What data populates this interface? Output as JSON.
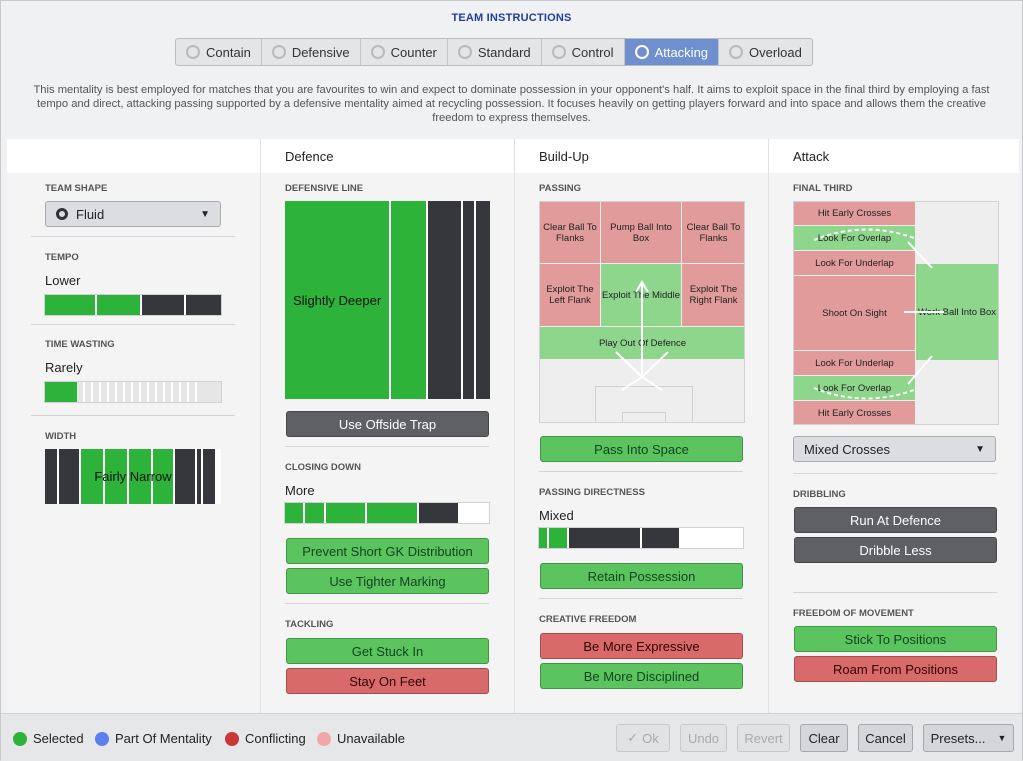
{
  "title": "TEAM INSTRUCTIONS",
  "tabs": [
    {
      "label": "Contain",
      "icon": "contain-icon",
      "active": false
    },
    {
      "label": "Defensive",
      "icon": "shield-icon",
      "active": false
    },
    {
      "label": "Counter",
      "icon": "counter-icon",
      "active": false
    },
    {
      "label": "Standard",
      "icon": "standard-icon",
      "active": false
    },
    {
      "label": "Control",
      "icon": "control-icon",
      "active": false
    },
    {
      "label": "Attacking",
      "icon": "attacking-icon",
      "active": true
    },
    {
      "label": "Overload",
      "icon": "overload-icon",
      "active": false
    }
  ],
  "description": "This mentality is best employed for matches that you are favourites to win and expect to dominate possession in your opponent's half. It aims to exploit space in the final third by employing a fast tempo and direct, attacking passing supported by a defensive mentality aimed at recycling possession. It focuses heavily on getting players forward and into space and allows them the creative freedom to express themselves.",
  "columns": {
    "defence": "Defence",
    "buildup": "Build-Up",
    "attack": "Attack"
  },
  "left": {
    "team_shape_label": "TEAM SHAPE",
    "team_shape_value": "Fluid",
    "tempo_label": "TEMPO",
    "tempo_value": "Lower",
    "time_wasting_label": "TIME WASTING",
    "time_wasting_value": "Rarely",
    "width_label": "WIDTH",
    "width_value": "Fairly Narrow"
  },
  "defence": {
    "defensive_line_label": "DEFENSIVE LINE",
    "defensive_line_value": "Slightly Deeper",
    "offside_trap": "Use Offside Trap",
    "closing_down_label": "CLOSING DOWN",
    "closing_down_value": "More",
    "prevent_gk": "Prevent Short GK Distribution",
    "tighter_marking": "Use Tighter Marking",
    "tackling_label": "TACKLING",
    "get_stuck_in": "Get Stuck In",
    "stay_on_feet": "Stay On Feet"
  },
  "buildup": {
    "passing_label": "PASSING",
    "clear_left": "Clear Ball To Flanks",
    "pump_box": "Pump Ball Into Box",
    "clear_right": "Clear Ball To Flanks",
    "exploit_left": "Exploit The Left Flank",
    "exploit_middle": "Exploit The Middle",
    "exploit_right": "Exploit The Right Flank",
    "play_out": "Play Out Of Defence",
    "pass_into_space": "Pass Into Space",
    "directness_label": "PASSING DIRECTNESS",
    "directness_value": "Mixed",
    "retain_possession": "Retain Possession",
    "creative_label": "CREATIVE FREEDOM",
    "be_expressive": "Be More Expressive",
    "be_disciplined": "Be More Disciplined"
  },
  "attack": {
    "final_third_label": "FINAL THIRD",
    "hit_early_top": "Hit Early Crosses",
    "overlap_top": "Look For Overlap",
    "underlap_top": "Look For Underlap",
    "shoot_on_sight": "Shoot On Sight",
    "work_ball": "Work Ball Into Box",
    "underlap_bottom": "Look For Underlap",
    "overlap_bottom": "Look For Overlap",
    "hit_early_bottom": "Hit Early Crosses",
    "crosses_value": "Mixed Crosses",
    "dribbling_label": "DRIBBLING",
    "run_at_defence": "Run At Defence",
    "dribble_less": "Dribble Less",
    "freedom_label": "FREEDOM OF MOVEMENT",
    "stick_positions": "Stick To Positions",
    "roam_positions": "Roam From Positions"
  },
  "legend": [
    {
      "label": "Selected",
      "color": "#2db33a"
    },
    {
      "label": "Part Of Mentality",
      "color": "#5b7ff0"
    },
    {
      "label": "Conflicting",
      "color": "#c93737"
    },
    {
      "label": "Unavailable",
      "color": "#f0a7a7"
    }
  ],
  "footer": {
    "ok": "Ok",
    "undo": "Undo",
    "revert": "Revert",
    "clear": "Clear",
    "cancel": "Cancel",
    "presets": "Presets..."
  }
}
